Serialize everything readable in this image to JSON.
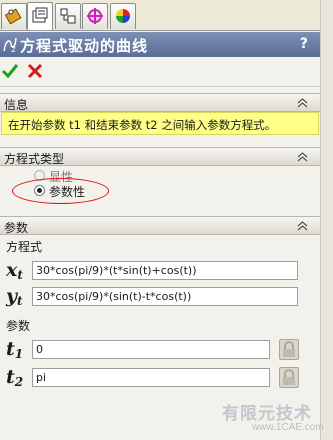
{
  "tabs": [
    {
      "icon": "feature-tree-icon"
    },
    {
      "icon": "property-manager-icon"
    },
    {
      "icon": "configuration-manager-icon"
    },
    {
      "icon": "dimxpert-icon"
    },
    {
      "icon": "display-manager-icon"
    }
  ],
  "panel": {
    "title": "方程式驱动的曲线",
    "help": "?",
    "ok_icon": "check-icon",
    "cancel_icon": "close-icon"
  },
  "info": {
    "header": "信息",
    "message": "在开始参数 t1 和结束参数 t2 之间输入参数方程式。"
  },
  "eq_type": {
    "header": "方程式类型",
    "options": [
      {
        "label": "显性",
        "selected": false,
        "enabled": false
      },
      {
        "label": "参数性",
        "selected": true,
        "enabled": true
      }
    ]
  },
  "params": {
    "header": "参数",
    "equation_label": "方程式",
    "xt": {
      "sym": "x",
      "sub": "t",
      "value": "30*cos(pi/9)*(t*sin(t)+cos(t))"
    },
    "yt": {
      "sym": "y",
      "sub": "t",
      "value": "30*cos(pi/9)*(sin(t)-t*cos(t))"
    },
    "param_label": "参数",
    "t1": {
      "sym": "t",
      "sub": "1",
      "value": "0"
    },
    "t2": {
      "sym": "t",
      "sub": "2",
      "value": "pi"
    }
  },
  "watermark": {
    "line1": "有限元技术",
    "line2": "www.1CAE.com"
  },
  "colors": {
    "title_bar": "#6a7ca3",
    "info_bg": "#ffff88",
    "ok": "#1aa01a",
    "cancel": "#d41a1a",
    "highlight_ellipse": "#dd1111"
  }
}
